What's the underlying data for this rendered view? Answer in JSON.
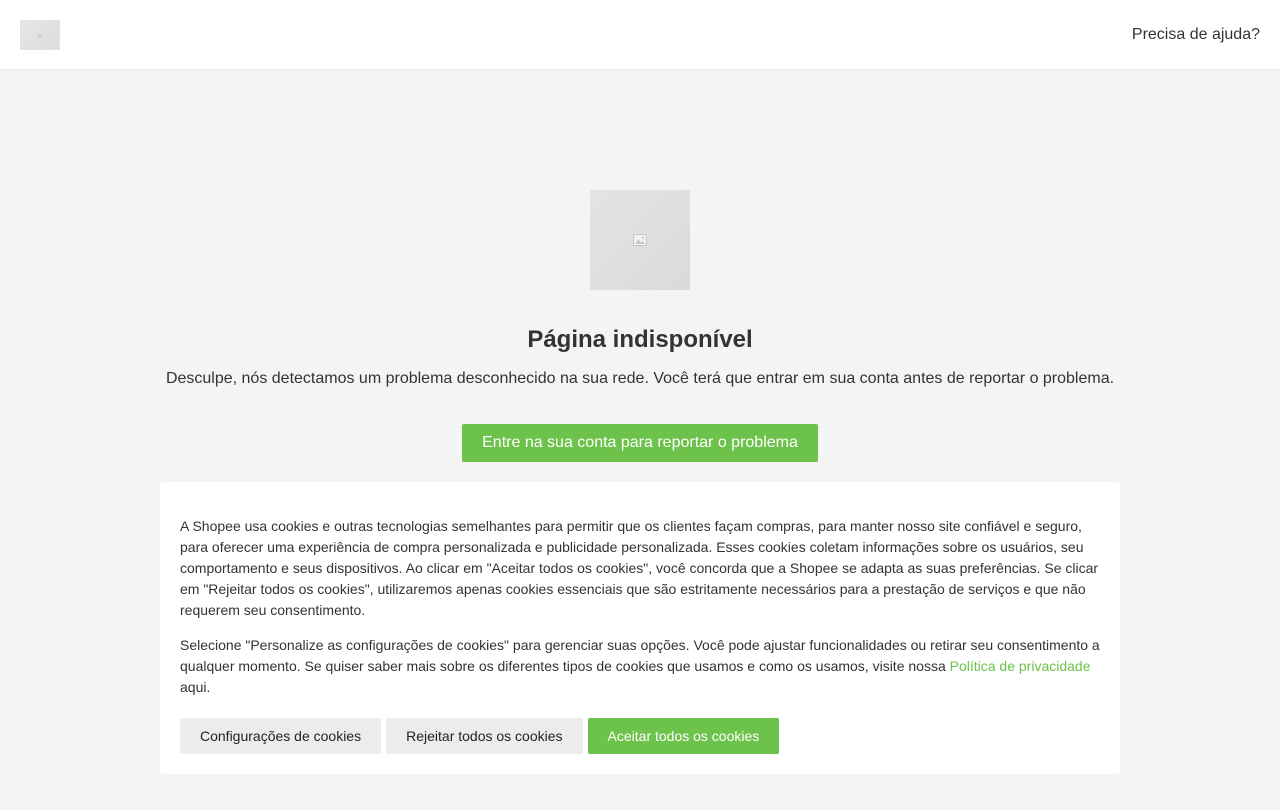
{
  "header": {
    "help_label": "Precisa de ajuda?"
  },
  "error": {
    "title": "Página indisponível",
    "description": "Desculpe, nós detectamos um problema desconhecido na sua rede. Você terá que entrar em sua conta antes de reportar o problema.",
    "login_button_label": "Entre na sua conta para reportar o problema"
  },
  "cookies": {
    "paragraph_1": "A Shopee usa cookies e outras tecnologias semelhantes para permitir que os clientes façam compras, para manter nosso site confiável e seguro, para oferecer uma experiência de compra personalizada e publicidade personalizada. Esses cookies coletam informações sobre os usuários, seu comportamento e seus dispositivos. Ao clicar em \"Aceitar todos os cookies\", você concorda que a Shopee se adapta as suas preferências. Se clicar em \"Rejeitar todos os cookies\", utilizaremos apenas cookies essenciais que são estritamente necessários para a prestação de serviços e que não requerem seu consentimento.",
    "paragraph_2_before_link": "Selecione \"Personalize as configurações de cookies\" para gerenciar suas opções. Você pode ajustar funcionalidades ou retirar seu consentimento a qualquer momento. Se quiser saber mais sobre os diferentes tipos de cookies que usamos e como os usamos, visite nossa ",
    "privacy_link_label": "Política de privacidade",
    "paragraph_2_after_link": " aqui.",
    "settings_button_label": "Configurações de cookies",
    "reject_button_label": "Rejeitar todos os cookies",
    "accept_button_label": "Aceitar todos os cookies"
  },
  "colors": {
    "accent_green": "#6cc24a",
    "header_bg": "#ffffff",
    "page_bg": "#f4f4f4",
    "secondary_button_bg": "#ececec"
  },
  "icons": {
    "logo": "logo-placeholder-icon",
    "hero": "image-placeholder-icon"
  }
}
